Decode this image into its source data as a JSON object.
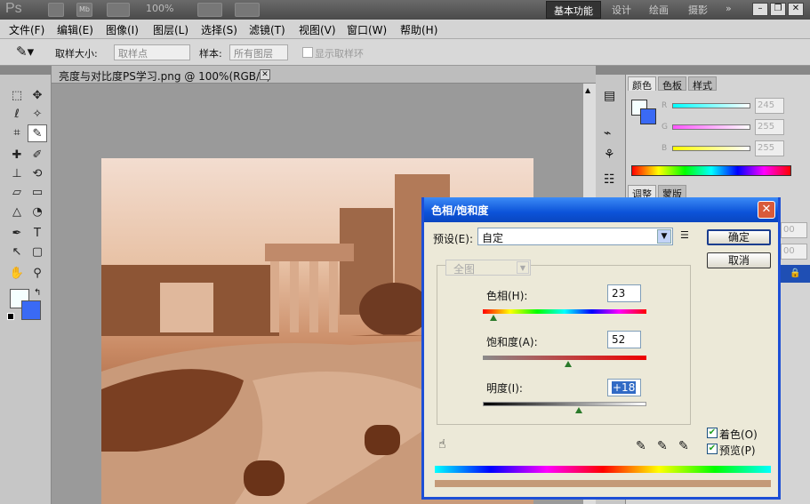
{
  "app": {
    "logo": "Ps",
    "zoom": "100%",
    "workspaces": [
      "基本功能",
      "设计",
      "绘画",
      "摄影"
    ],
    "workspace_more": "»"
  },
  "menu": [
    "文件(F)",
    "编辑(E)",
    "图像(I)",
    "图层(L)",
    "选择(S)",
    "滤镜(T)",
    "视图(V)",
    "窗口(W)",
    "帮助(H)"
  ],
  "options": {
    "sample_size_label": "取样大小:",
    "sample_size_value": "取样点",
    "sample_label": "样本:",
    "sample_value": "所有图层",
    "show_ring": "显示取样环"
  },
  "document": {
    "tab_title": "亮度与对比度PS学习.png @ 100%(RGB/8)"
  },
  "color_panel": {
    "tabs": [
      "颜色",
      "色板",
      "样式"
    ],
    "r": "245",
    "g": "255",
    "b": "255",
    "labels": [
      "R",
      "G",
      "B"
    ]
  },
  "adjust_panel": {
    "tabs": [
      "调整",
      "蒙版"
    ],
    "values": [
      "00",
      "00"
    ]
  },
  "dialog": {
    "title": "色相/饱和度",
    "preset_label": "预设(E):",
    "preset_value": "自定",
    "ok": "确定",
    "cancel": "取消",
    "channel": "全图",
    "hue_label": "色相(H):",
    "hue_value": "23",
    "sat_label": "饱和度(A):",
    "sat_value": "52",
    "light_label": "明度(I):",
    "light_value": "+18",
    "colorize_label": "着色(O)",
    "preview_label": "预览(P)",
    "result_color": "#c49a78"
  }
}
